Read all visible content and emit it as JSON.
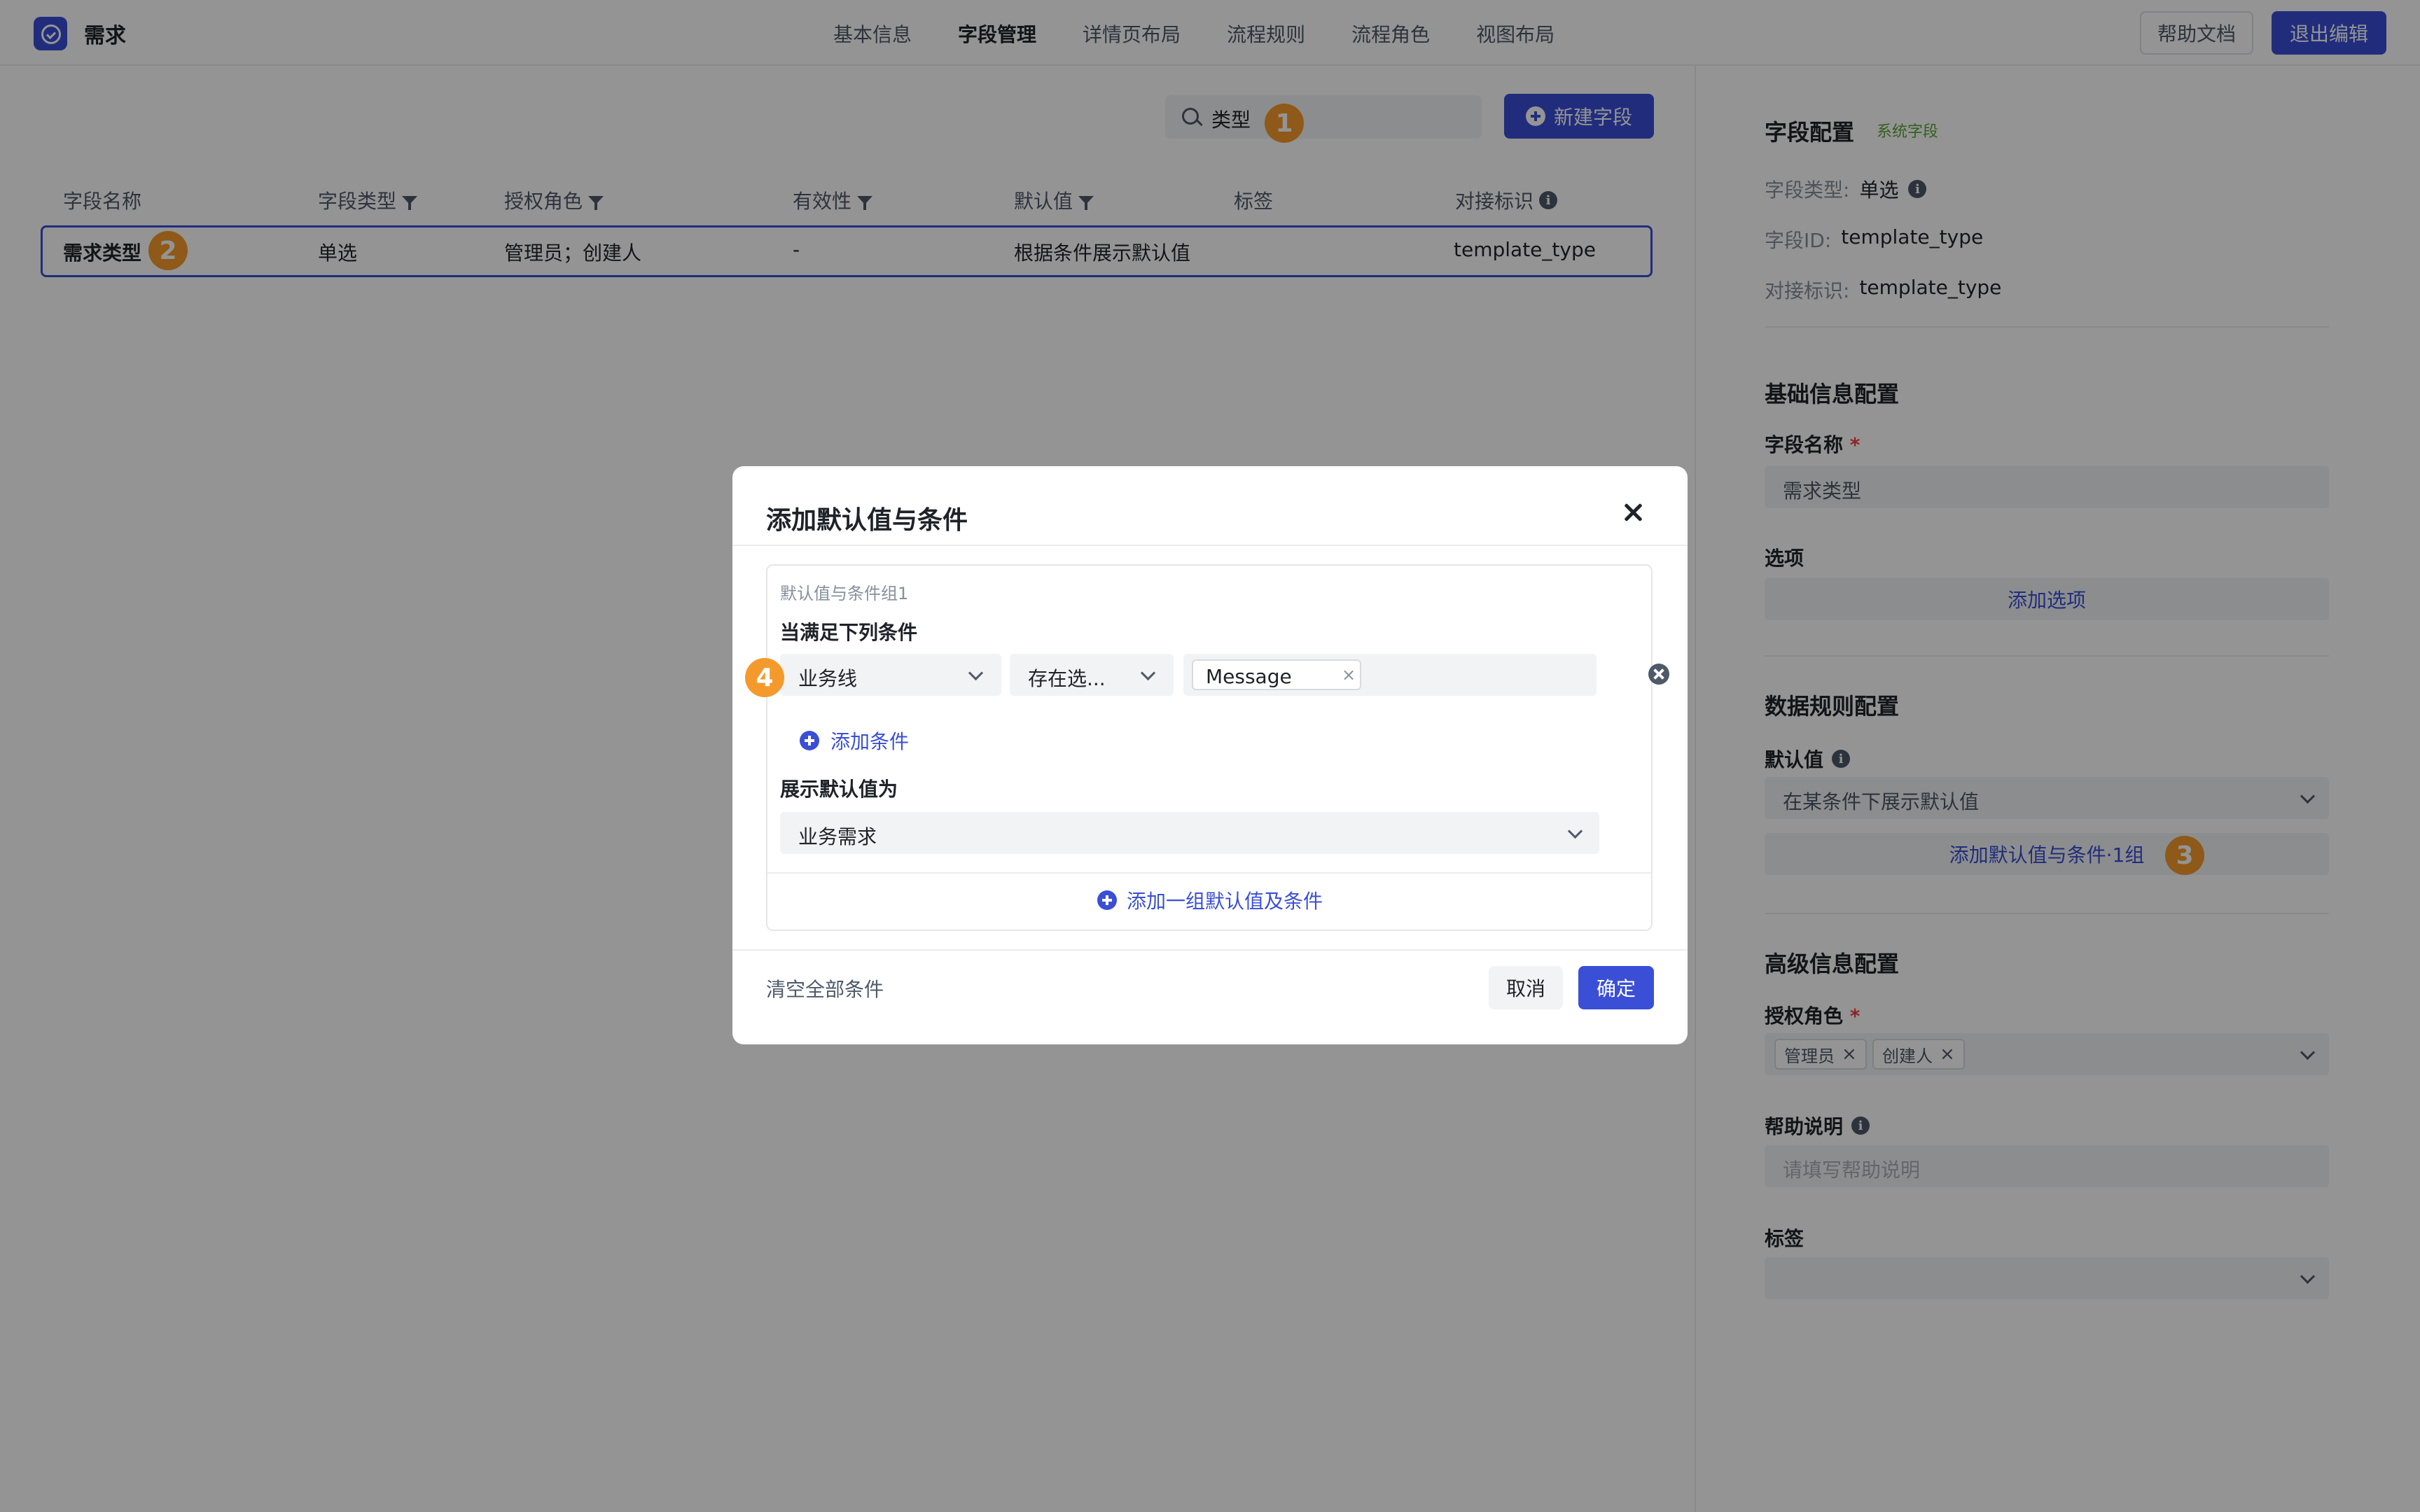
{
  "app": {
    "title": "需求"
  },
  "nav": [
    "基本信息",
    "字段管理",
    "详情页布局",
    "流程规则",
    "流程角色",
    "视图布局"
  ],
  "header_buttons": {
    "help": "帮助文档",
    "exit": "退出编辑"
  },
  "search": {
    "value": "类型"
  },
  "new_field_button": "新建字段",
  "table": {
    "columns": [
      "字段名称",
      "字段类型",
      "授权角色",
      "有效性",
      "默认值",
      "标签",
      "对接标识"
    ],
    "rows": [
      [
        "需求类型",
        "单选",
        "管理员；创建人",
        "-",
        "根据条件展示默认值",
        "",
        "template_type"
      ]
    ]
  },
  "callouts": [
    "1",
    "2",
    "3",
    "4"
  ],
  "panel": {
    "title": "字段配置",
    "system_tag": "系统字段",
    "type_label": "字段类型:",
    "type_value": "单选",
    "id_label": "字段ID:",
    "id_value": "template_type",
    "api_label": "对接标识:",
    "api_value": "template_type",
    "basic_title": "基础信息配置",
    "name_label": "字段名称",
    "required_mark": "*",
    "name_value": "需求类型",
    "options_label": "选项",
    "add_option": "添加选项",
    "data_rule_title": "数据规则配置",
    "default_label": "默认值",
    "default_value": "在某条件下展示默认值",
    "add_default_link": "添加默认值与条件·1组",
    "advanced_title": "高级信息配置",
    "roles_label": "授权角色",
    "roles": [
      "管理员",
      "创建人"
    ],
    "help_label": "帮助说明",
    "help_placeholder": "请填写帮助说明",
    "tags_label": "标签"
  },
  "modal": {
    "title": "添加默认值与条件",
    "group_label": "默认值与条件组1",
    "condition_heading": "当满足下列条件",
    "field_select": "业务线",
    "operator_select": "存在选...",
    "value_tag": "Message",
    "add_condition": "添加条件",
    "show_default_label": "展示默认值为",
    "default_select": "业务需求",
    "add_group": "添加一组默认值及条件",
    "clear_all": "清空全部条件",
    "cancel": "取消",
    "confirm": "确定"
  },
  "colors": {
    "primary": "#3a4fd6",
    "callout": "#f49a2c",
    "system_tag": "#5aa631",
    "required": "#f53f3f"
  }
}
